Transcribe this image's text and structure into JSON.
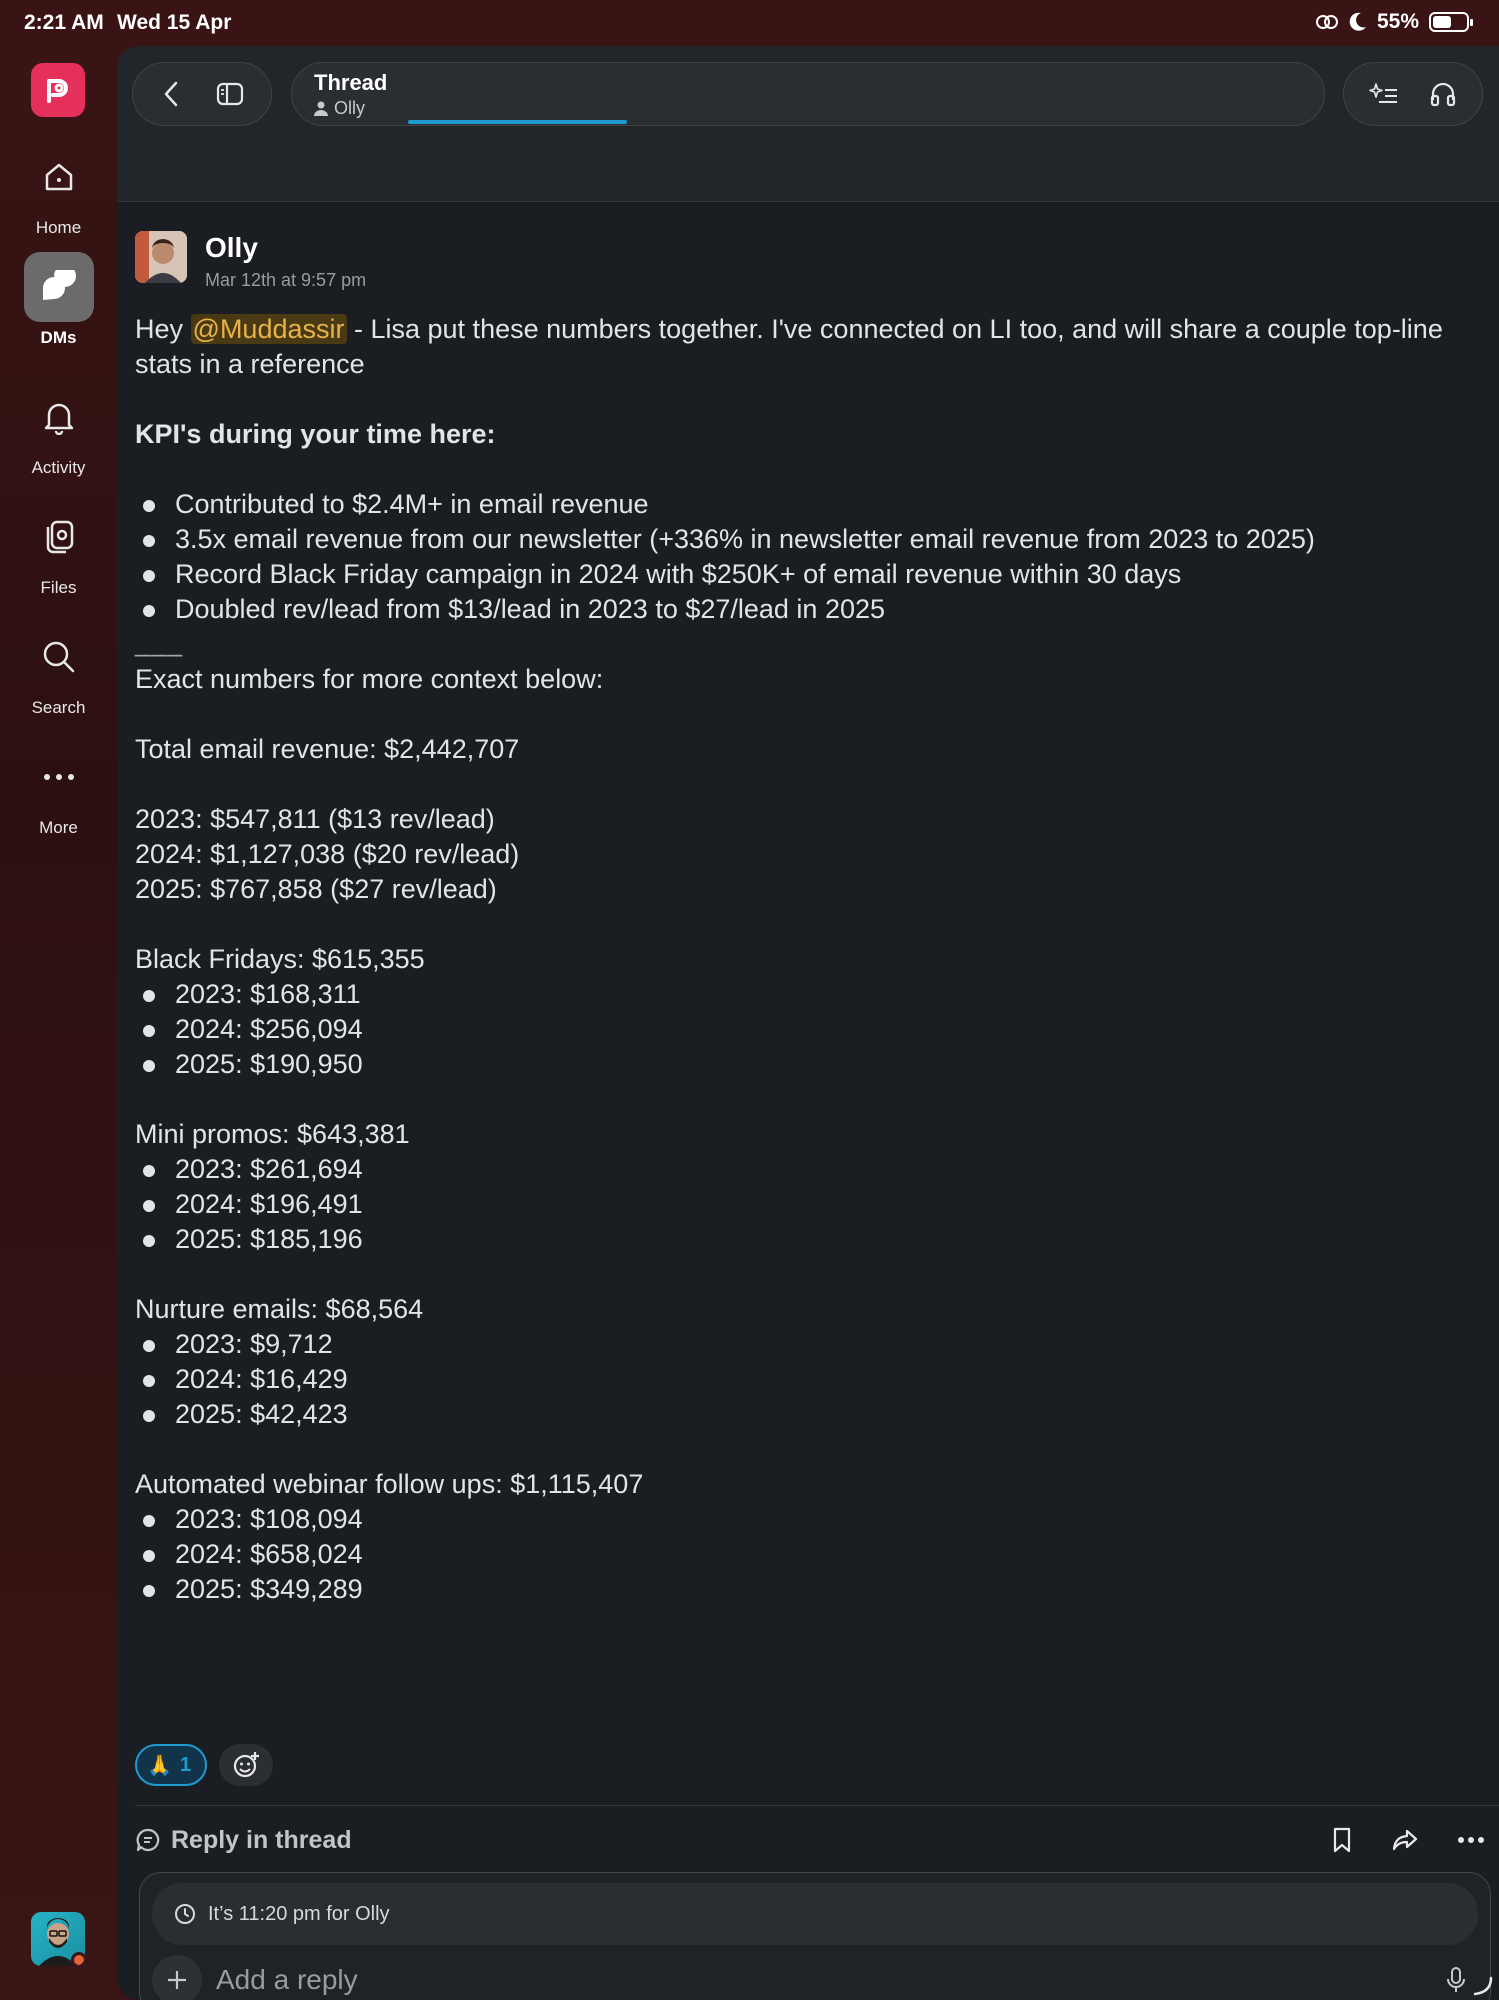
{
  "status_bar": {
    "time": "2:21 AM",
    "date": "Wed 15 Apr",
    "battery": "55%",
    "battery_level": 0.55
  },
  "sidebar": {
    "items": [
      {
        "label": "Home",
        "icon": "home-icon"
      },
      {
        "label": "DMs",
        "icon": "dms-icon",
        "active": true
      },
      {
        "label": "Activity",
        "icon": "bell-icon"
      },
      {
        "label": "Files",
        "icon": "files-icon"
      },
      {
        "label": "Search",
        "icon": "search-icon"
      },
      {
        "label": "More",
        "icon": "more-icon"
      }
    ]
  },
  "header": {
    "title": "Thread",
    "subtitle": "Olly"
  },
  "message": {
    "author": "Olly",
    "timestamp": "Mar 12th at 9:57 pm",
    "intro_pre": "Hey ",
    "mention": "@Muddassir",
    "intro_post": " - Lisa put these numbers together. I've connected on LI too, and will share a couple top-line stats in a reference",
    "kpi_heading": "KPI's during your time here:",
    "kpis": [
      "Contributed to $2.4M+ in email revenue",
      "3.5x email revenue from our newsletter (+336% in newsletter email revenue from 2023 to 2025)",
      "Record Black Friday campaign in 2024 with $250K+ of email revenue within 30 days",
      "Doubled rev/lead from $13/lead in 2023 to $27/lead in 2025"
    ],
    "separator": "___",
    "context_line": "Exact numbers for more context below:",
    "total": "Total email revenue: $2,442,707",
    "years": [
      "2023: $547,811 ($13 rev/lead)",
      "2024: $1,127,038 ($20 rev/lead)",
      "2025: $767,858 ($27 rev/lead)"
    ],
    "black_fridays": {
      "title": "Black Fridays: $615,355",
      "items": [
        "2023: $168,311",
        "2024: $256,094",
        "2025: $190,950"
      ]
    },
    "mini_promos": {
      "title": "Mini promos: $643,381",
      "items": [
        "2023: $261,694",
        "2024: $196,491",
        "2025: $185,196"
      ]
    },
    "nurture": {
      "title": "Nurture emails: $68,564",
      "items": [
        "2023: $9,712",
        "2024: $16,429",
        "2025: $42,423"
      ]
    },
    "webinar": {
      "title": "Automated webinar follow ups: $1,115,407",
      "items": [
        "2023: $108,094",
        "2024: $658,024",
        "2025: $349,289"
      ]
    },
    "reaction": {
      "emoji": "🙏",
      "count": "1"
    }
  },
  "thread_actions": {
    "reply_label": "Reply in thread"
  },
  "composer": {
    "local_time": "It’s 11:20 pm for Olly",
    "placeholder": "Add a reply"
  },
  "colors": {
    "accent": "#1d9bd1",
    "brand": "#e4305a",
    "mention_text": "#e8b24a",
    "background": "#1a1d21"
  }
}
